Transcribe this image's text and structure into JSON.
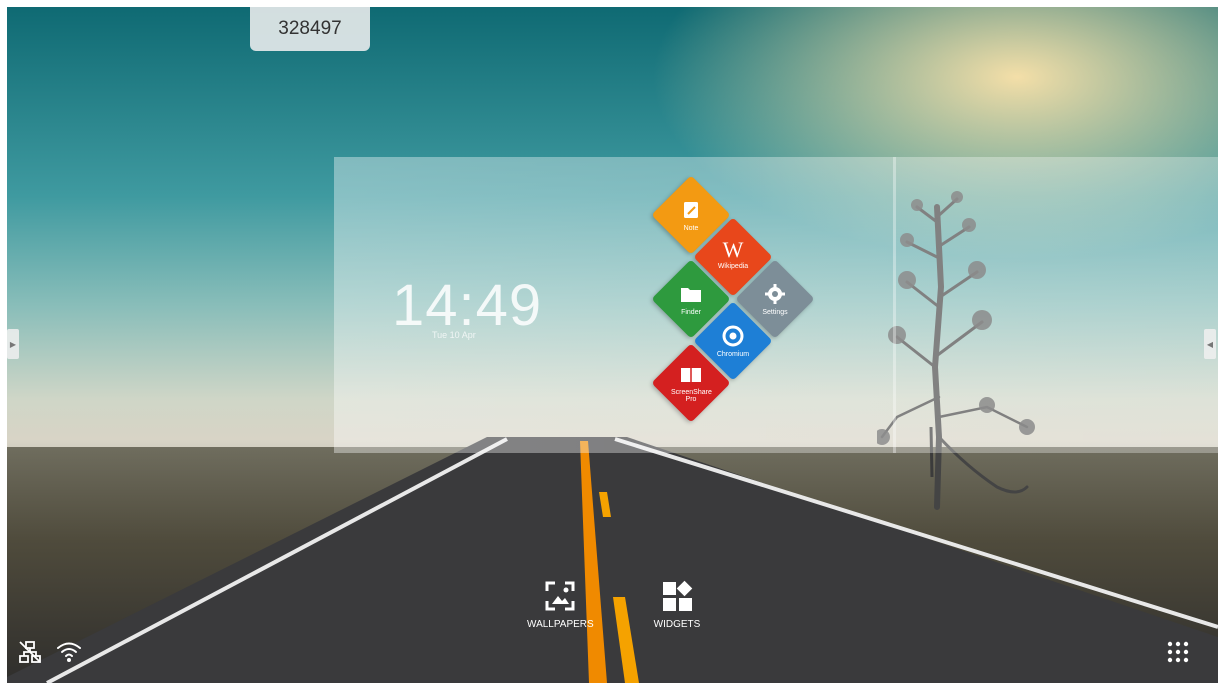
{
  "top_badge": {
    "code": "328497"
  },
  "clock_widget": {
    "time": "14:49",
    "date": "Tue 10 Apr"
  },
  "app_tiles": [
    {
      "name": "Note",
      "color": "#F39A12",
      "icon": "note-pencil-icon"
    },
    {
      "name": "Wikipedia",
      "color": "#E8471B",
      "icon": "wikipedia-w-icon"
    },
    {
      "name": "Finder",
      "color": "#2E9A3E",
      "icon": "folder-icon"
    },
    {
      "name": "Settings",
      "color": "#7D8E98",
      "icon": "gear-icon"
    },
    {
      "name": "Chromium",
      "color": "#1E7FD6",
      "icon": "chromium-icon"
    },
    {
      "name": "ScreenShare Pro",
      "color": "#D42020",
      "icon": "screenshare-icon"
    }
  ],
  "dock": {
    "wallpapers_label": "WALLPAPERS",
    "widgets_label": "WIDGETS"
  },
  "status_icons": [
    "ethernet-disconnected-icon",
    "wifi-icon"
  ],
  "app_drawer_icon": "apps-grid-icon"
}
